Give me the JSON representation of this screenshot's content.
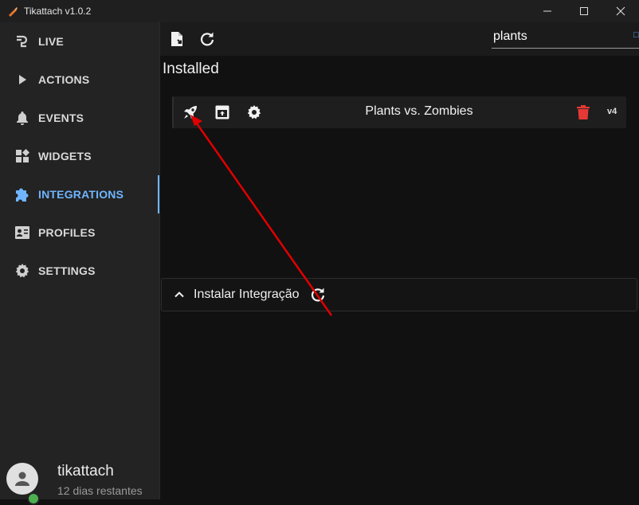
{
  "window": {
    "title": "Tikattach v1.0.2",
    "controls": [
      "minimize-icon",
      "maximize-icon",
      "close-icon"
    ]
  },
  "sidebar": {
    "items": [
      {
        "label": "LIVE",
        "icon": "plug-icon",
        "active": false
      },
      {
        "label": "ACTIONS",
        "icon": "play-icon",
        "active": false
      },
      {
        "label": "EVENTS",
        "icon": "bell-icon",
        "active": false
      },
      {
        "label": "WIDGETS",
        "icon": "widgets-icon",
        "active": false
      },
      {
        "label": "INTEGRATIONS",
        "icon": "puzzle-icon",
        "active": true
      },
      {
        "label": "PROFILES",
        "icon": "profile-card-icon",
        "active": false
      },
      {
        "label": "SETTINGS",
        "icon": "gear-icon",
        "active": false
      }
    ],
    "accent_color": "#6fb5ff"
  },
  "user": {
    "name": "tikattach",
    "status": "12 dias restantes",
    "online_color": "#4caf50"
  },
  "toolbar": {
    "icons": [
      "import-file-icon",
      "refresh-icon"
    ],
    "search_value": "plants"
  },
  "main": {
    "section_title": "Installed",
    "integrations": [
      {
        "name": "Plants vs. Zombies",
        "version": "v4",
        "actions": [
          "rocket-icon",
          "open-window-icon",
          "gear-icon",
          "trash-icon"
        ],
        "delete_color": "#e53935"
      }
    ],
    "install_panel": {
      "label": "Instalar Integração",
      "icons": [
        "chevron-up-icon",
        "refresh-icon"
      ]
    }
  },
  "annotation": {
    "arrow_color": "#e00000"
  }
}
